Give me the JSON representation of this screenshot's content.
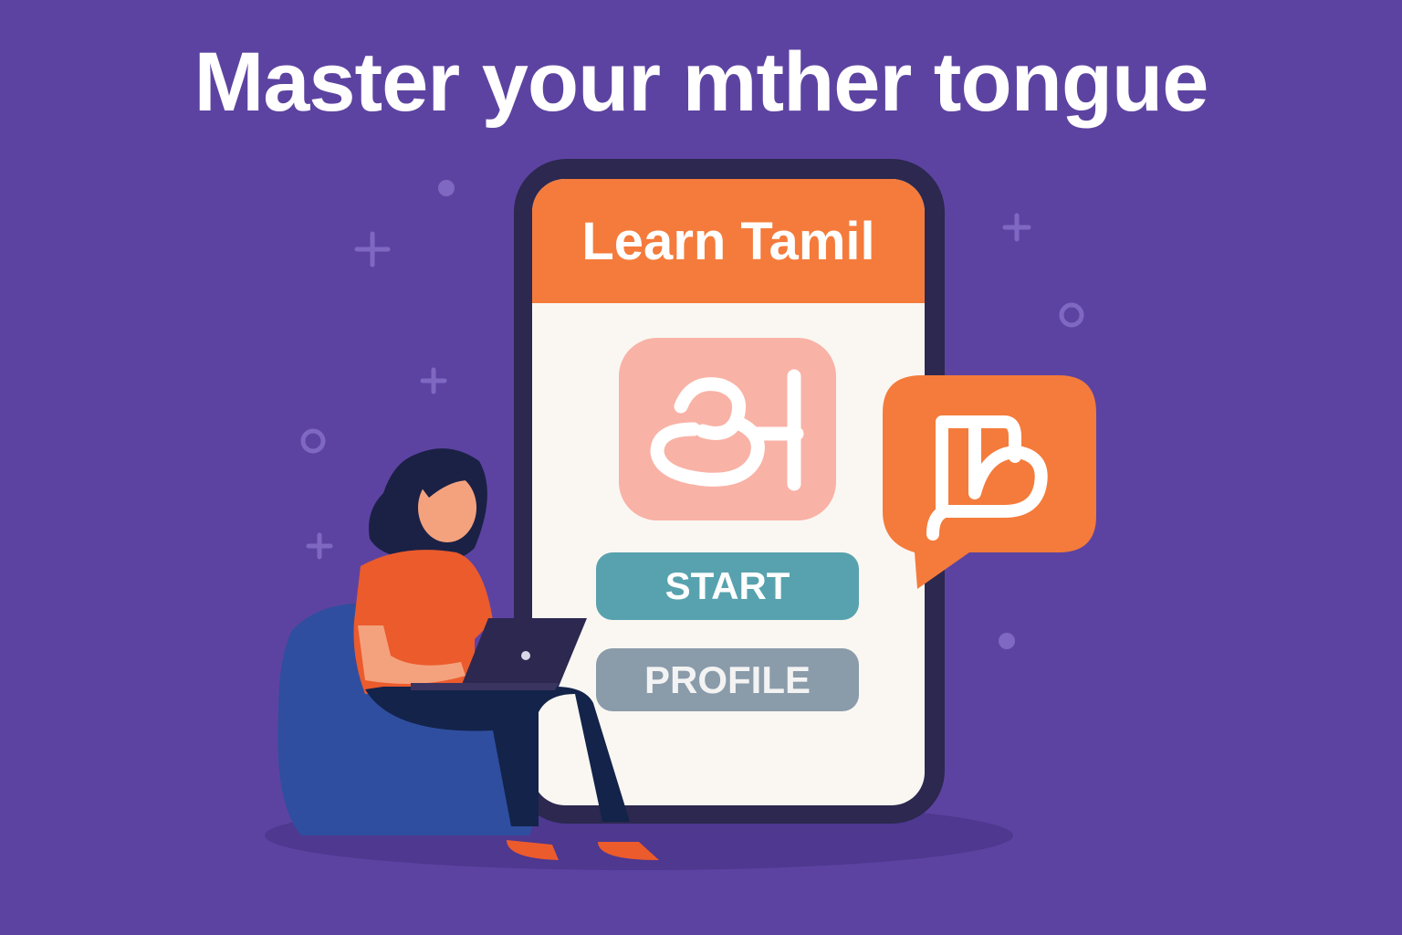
{
  "headline": "Master your mther tongue",
  "app": {
    "header_title": "Learn Tamil",
    "tile_letter": "அ",
    "bubble_letter": "ந",
    "start_label": "START",
    "profile_label": "PROFILE"
  },
  "colors": {
    "background": "#5D43A1",
    "accent_orange": "#F47B3B",
    "start_teal": "#58A2AF",
    "profile_gray": "#8A9BAA",
    "tile_pink": "#F9B2A6"
  }
}
